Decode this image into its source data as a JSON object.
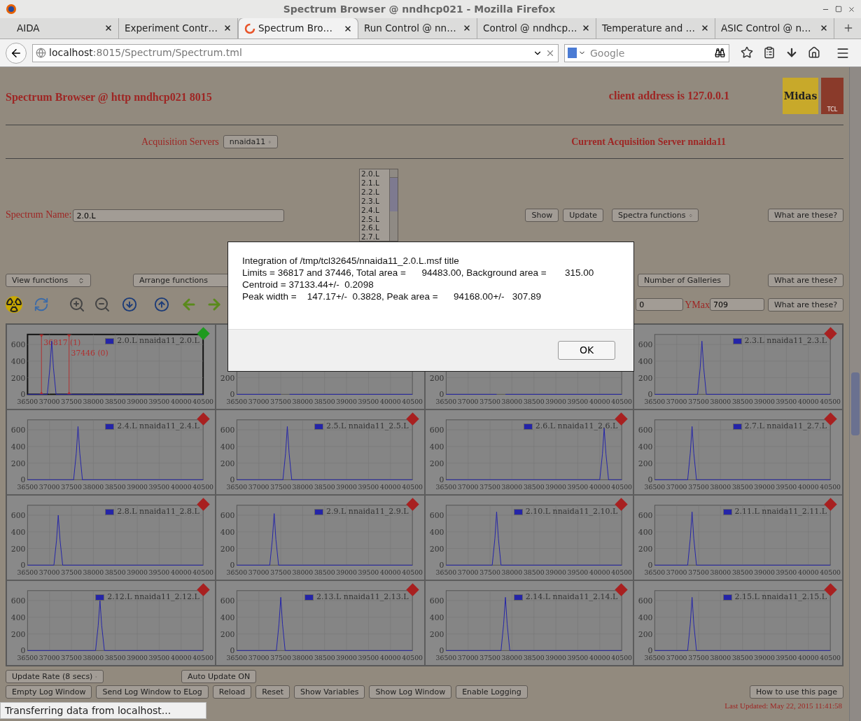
{
  "window": {
    "title": "Spectrum Browser @ nndhcp021 - Mozilla Firefox"
  },
  "tabs": [
    {
      "label": "AIDA",
      "selected": false
    },
    {
      "label": "Experiment Contr…",
      "selected": false
    },
    {
      "label": "Spectrum Bro…",
      "selected": true
    },
    {
      "label": "Run Control @ nn…",
      "selected": false
    },
    {
      "label": "Control @ nndhcp…",
      "selected": false
    },
    {
      "label": "Temperature and …",
      "selected": false
    },
    {
      "label": "ASIC Control @ n…",
      "selected": false
    }
  ],
  "address_bar": {
    "host": "localhost",
    "path": ":8015/Spectrum/Spectrum.tml"
  },
  "search": {
    "placeholder": "Google"
  },
  "page": {
    "title": "Spectrum Browser @ http nndhcp021 8015",
    "client_address": "client address is 127.0.0.1",
    "logos": [
      "Midas",
      "TCL"
    ],
    "acquisition_servers": {
      "label": "Acquisition Servers",
      "value": "nnaida11"
    },
    "current_server": "Current Acquisition Server nnaida11",
    "spectrum_name": {
      "label": "Spectrum Name:",
      "value": "2.0.L"
    },
    "spectrum_list": [
      "2.0.L",
      "2.1.L",
      "2.2.L",
      "2.3.L",
      "2.4.L",
      "2.5.L",
      "2.6.L",
      "2.7.L"
    ],
    "row1_buttons": [
      "Show",
      "Update"
    ],
    "spectra_functions": "Spectra functions",
    "help_buttons": [
      "What are these?",
      "What are these?",
      "What are these?"
    ],
    "view_functions": "View functions",
    "arrange_functions": "Arrange functions",
    "number_of_galleries": "Number of Galleries",
    "ymin_value": "0",
    "ymax": {
      "label": "YMax",
      "value": "709"
    },
    "panels": [
      {
        "active": true,
        "chart_data": {
          "type": "line",
          "x": [
            36500,
            36950,
            37010,
            37050,
            37090,
            37150,
            40500
          ],
          "series": [
            {
              "name": "2.0.L nnaida11_2.0.L",
              "color": "#2424a8",
              "values": [
                0,
                0,
                320,
                640,
                320,
                0,
                0
              ]
            }
          ],
          "xlim": [
            36500,
            40500
          ],
          "ylim": [
            0,
            720
          ],
          "xticks": [
            36500,
            37000,
            37500,
            38000,
            38500,
            39000,
            39500,
            40000,
            40500
          ],
          "yticks": [
            0,
            200,
            400,
            600
          ],
          "grid": true,
          "ref_lines": [
            {
              "axis": "x",
              "value": 36817,
              "label": "36817 (1)",
              "color": "#b03030"
            },
            {
              "axis": "x",
              "value": 37446,
              "label": "37446 (0)",
              "color": "#b03030"
            }
          ]
        }
      },
      {
        "chart_data": {
          "type": "line",
          "x": [
            36500,
            37500,
            37560,
            37600,
            37640,
            37700,
            40500
          ],
          "series": [
            {
              "color": "#2424a8",
              "values": [
                0,
                0,
                null,
                null,
                null,
                0,
                0
              ]
            }
          ],
          "xlim": [
            36500,
            40500
          ],
          "ylim": [
            0,
            720
          ],
          "xticks": [
            36500,
            37000,
            37500,
            38000,
            38500,
            39000,
            39500,
            40000,
            40500
          ],
          "yticks": [
            0,
            200
          ],
          "grid": true
        }
      },
      {
        "chart_data": {
          "type": "line",
          "x": [
            36500,
            37650,
            37710,
            37750,
            37790,
            37850,
            40500
          ],
          "series": [
            {
              "color": "#2424a8",
              "values": [
                0,
                0,
                null,
                null,
                null,
                0,
                0
              ]
            }
          ],
          "xlim": [
            36500,
            40500
          ],
          "ylim": [
            0,
            720
          ],
          "xticks": [
            36500,
            37000,
            37500,
            38000,
            38500,
            39000,
            39500,
            40000,
            40500
          ],
          "yticks": [
            0,
            200
          ],
          "grid": true
        }
      },
      {
        "active": false,
        "chart_data": {
          "type": "line",
          "x": [
            36500,
            37475,
            37535,
            37575,
            37615,
            37675,
            40500
          ],
          "series": [
            {
              "name": "2.3.L nnaida11_2.3.L",
              "color": "#2424a8",
              "values": [
                0,
                0,
                320,
                640,
                320,
                0,
                0
              ]
            }
          ],
          "xlim": [
            36500,
            40500
          ],
          "ylim": [
            0,
            720
          ],
          "xticks": [
            36500,
            37000,
            37500,
            38000,
            38500,
            39000,
            39500,
            40000,
            40500
          ],
          "yticks": [
            0,
            200,
            400,
            600
          ],
          "grid": true
        }
      },
      {
        "active": false,
        "chart_data": {
          "type": "line",
          "x": [
            36500,
            37550,
            37610,
            37650,
            37690,
            37750,
            40500
          ],
          "series": [
            {
              "name": "2.4.L nnaida11_2.4.L",
              "color": "#2424a8",
              "values": [
                0,
                0,
                320,
                640,
                320,
                0,
                0
              ]
            }
          ],
          "xlim": [
            36500,
            40500
          ],
          "ylim": [
            0,
            720
          ],
          "xticks": [
            36500,
            37000,
            37500,
            38000,
            38500,
            39000,
            39500,
            40000,
            40500
          ],
          "yticks": [
            0,
            200,
            400,
            600
          ],
          "grid": true
        }
      },
      {
        "active": false,
        "chart_data": {
          "type": "line",
          "x": [
            36500,
            37550,
            37610,
            37650,
            37690,
            37750,
            40500
          ],
          "series": [
            {
              "name": "2.5.L nnaida11_2.5.L",
              "color": "#2424a8",
              "values": [
                0,
                0,
                320,
                640,
                320,
                0,
                0
              ]
            }
          ],
          "xlim": [
            36500,
            40500
          ],
          "ylim": [
            0,
            720
          ],
          "xticks": [
            36500,
            37000,
            37500,
            38000,
            38500,
            39000,
            39500,
            40000,
            40500
          ],
          "yticks": [
            0,
            200,
            400,
            600
          ],
          "grid": true
        }
      },
      {
        "active": false,
        "chart_data": {
          "type": "line",
          "x": [
            36500,
            40000,
            40060,
            40100,
            40140,
            40200,
            40500
          ],
          "series": [
            {
              "name": "2.6.L nnaida11_2.6.L",
              "color": "#2424a8",
              "values": [
                0,
                0,
                310,
                620,
                310,
                0,
                0
              ]
            }
          ],
          "xlim": [
            36500,
            40500
          ],
          "ylim": [
            0,
            720
          ],
          "xticks": [
            36500,
            37000,
            37500,
            38000,
            38500,
            39000,
            39500,
            40000,
            40500
          ],
          "yticks": [
            0,
            200,
            400,
            600
          ],
          "grid": true
        }
      },
      {
        "active": false,
        "chart_data": {
          "type": "line",
          "x": [
            36500,
            37250,
            37310,
            37350,
            37390,
            37450,
            40500
          ],
          "series": [
            {
              "name": "2.7.L nnaida11_2.7.L",
              "color": "#2424a8",
              "values": [
                0,
                0,
                320,
                640,
                320,
                0,
                0
              ]
            }
          ],
          "xlim": [
            36500,
            40500
          ],
          "ylim": [
            0,
            720
          ],
          "xticks": [
            36500,
            37000,
            37500,
            38000,
            38500,
            39000,
            39500,
            40000,
            40500
          ],
          "yticks": [
            0,
            200,
            400,
            600
          ],
          "grid": true
        }
      },
      {
        "active": false,
        "chart_data": {
          "type": "line",
          "x": [
            36500,
            37100,
            37160,
            37200,
            37240,
            37300,
            40500
          ],
          "series": [
            {
              "name": "2.8.L nnaida11_2.8.L",
              "color": "#2424a8",
              "values": [
                0,
                0,
                300,
                600,
                300,
                0,
                0
              ]
            }
          ],
          "xlim": [
            36500,
            40500
          ],
          "ylim": [
            0,
            720
          ],
          "xticks": [
            36500,
            37000,
            37500,
            38000,
            38500,
            39000,
            39500,
            40000,
            40500
          ],
          "yticks": [
            0,
            200,
            400,
            600
          ],
          "grid": true
        }
      },
      {
        "active": false,
        "chart_data": {
          "type": "line",
          "x": [
            36500,
            37250,
            37310,
            37350,
            37390,
            37450,
            40500
          ],
          "series": [
            {
              "name": "2.9.L nnaida11_2.9.L",
              "color": "#2424a8",
              "values": [
                0,
                0,
                310,
                620,
                310,
                0,
                0
              ]
            }
          ],
          "xlim": [
            36500,
            40500
          ],
          "ylim": [
            0,
            720
          ],
          "xticks": [
            36500,
            37000,
            37500,
            38000,
            38500,
            39000,
            39500,
            40000,
            40500
          ],
          "yticks": [
            0,
            200,
            400,
            600
          ],
          "grid": true
        }
      },
      {
        "active": false,
        "chart_data": {
          "type": "line",
          "x": [
            36500,
            37550,
            37610,
            37650,
            37690,
            37750,
            40500
          ],
          "series": [
            {
              "name": "2.10.L nnaida11_2.10.L",
              "color": "#2424a8",
              "values": [
                0,
                0,
                320,
                640,
                320,
                0,
                0
              ]
            }
          ],
          "xlim": [
            36500,
            40500
          ],
          "ylim": [
            0,
            720
          ],
          "xticks": [
            36500,
            37000,
            37500,
            38000,
            38500,
            39000,
            39500,
            40000,
            40500
          ],
          "yticks": [
            0,
            200,
            400,
            600
          ],
          "grid": true
        }
      },
      {
        "active": false,
        "chart_data": {
          "type": "line",
          "x": [
            36500,
            37250,
            37310,
            37350,
            37390,
            37450,
            40500
          ],
          "series": [
            {
              "name": "2.11.L nnaida11_2.11.L",
              "color": "#2424a8",
              "values": [
                0,
                0,
                320,
                640,
                320,
                0,
                0
              ]
            }
          ],
          "xlim": [
            36500,
            40500
          ],
          "ylim": [
            0,
            720
          ],
          "xticks": [
            36500,
            37000,
            37500,
            38000,
            38500,
            39000,
            39500,
            40000,
            40500
          ],
          "yticks": [
            0,
            200,
            400,
            600
          ],
          "grid": true
        }
      },
      {
        "active": false,
        "chart_data": {
          "type": "line",
          "x": [
            36500,
            38050,
            38110,
            38150,
            38190,
            38250,
            40500
          ],
          "series": [
            {
              "name": "2.12.L nnaida11_2.12.L",
              "color": "#2424a8",
              "values": [
                0,
                0,
                300,
                600,
                300,
                0,
                0
              ]
            }
          ],
          "xlim": [
            36500,
            40500
          ],
          "ylim": [
            0,
            720
          ],
          "xticks": [
            36500,
            37000,
            37500,
            38000,
            38500,
            39000,
            39500,
            40000,
            40500
          ],
          "yticks": [
            0,
            200,
            400,
            600
          ],
          "grid": true
        }
      },
      {
        "active": false,
        "chart_data": {
          "type": "line",
          "x": [
            36500,
            37400,
            37460,
            37500,
            37540,
            37600,
            40500
          ],
          "series": [
            {
              "name": "2.13.L nnaida11_2.13.L",
              "color": "#2424a8",
              "values": [
                0,
                0,
                320,
                640,
                320,
                0,
                0
              ]
            }
          ],
          "xlim": [
            36500,
            40500
          ],
          "ylim": [
            0,
            720
          ],
          "xticks": [
            36500,
            37000,
            37500,
            38000,
            38500,
            39000,
            39500,
            40000,
            40500
          ],
          "yticks": [
            0,
            200,
            400,
            600
          ],
          "grid": true
        }
      },
      {
        "active": false,
        "chart_data": {
          "type": "line",
          "x": [
            36500,
            37750,
            37810,
            37850,
            37890,
            37950,
            40500
          ],
          "series": [
            {
              "name": "2.14.L nnaida11_2.14.L",
              "color": "#2424a8",
              "values": [
                0,
                0,
                320,
                640,
                320,
                0,
                0
              ]
            }
          ],
          "xlim": [
            36500,
            40500
          ],
          "ylim": [
            0,
            720
          ],
          "xticks": [
            36500,
            37000,
            37500,
            38000,
            38500,
            39000,
            39500,
            40000,
            40500
          ],
          "yticks": [
            0,
            200,
            400,
            600
          ],
          "grid": true
        }
      },
      {
        "active": false,
        "chart_data": {
          "type": "line",
          "x": [
            36500,
            37250,
            37310,
            37350,
            37390,
            37450,
            40500
          ],
          "series": [
            {
              "name": "2.15.L nnaida11_2.15.L",
              "color": "#2424a8",
              "values": [
                0,
                0,
                320,
                640,
                320,
                0,
                0
              ]
            }
          ],
          "xlim": [
            36500,
            40500
          ],
          "ylim": [
            0,
            720
          ],
          "xticks": [
            36500,
            37000,
            37500,
            38000,
            38500,
            39000,
            39500,
            40000,
            40500
          ],
          "yticks": [
            0,
            200,
            400,
            600
          ],
          "grid": true
        }
      }
    ],
    "update_rate": "Update Rate (8 secs)",
    "auto_update": "Auto Update ON",
    "bottom_buttons": [
      "Empty Log Window",
      "Send Log Window to ELog",
      "Reload",
      "Reset",
      "Show Variables",
      "Show Log Window",
      "Enable Logging"
    ],
    "help_page": "How to use this page",
    "last_updated": "Last Updated: May 22, 2015 11:41:58"
  },
  "dialog": {
    "lines": [
      "Integration of /tmp/tcl32645/nnaida11_2.0.L.msf title",
      "Limits = 36817 and 37446, Total area =      94483.00, Background area =       315.00",
      "Centroid = 37133.44+/-  0.2098",
      "Peak width =    147.17+/-  0.3828, Peak area =      94168.00+/-   307.89"
    ],
    "button": "OK"
  },
  "status_bar": "Transferring data from localhost..."
}
